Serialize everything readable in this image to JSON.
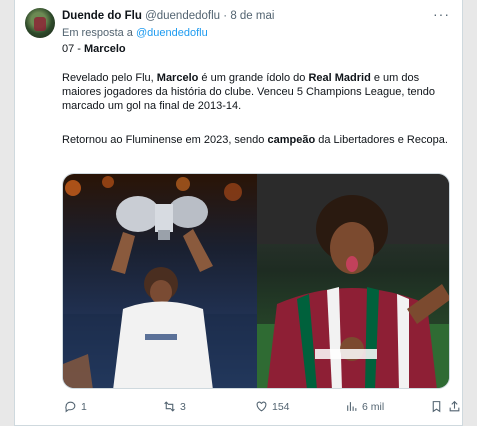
{
  "tweet": {
    "author_name": "Duende do Flu",
    "handle": "@duendedoflu",
    "separator": "·",
    "date": "8 de mai",
    "more_glyph": "···",
    "reply_prefix": "Em resposta a",
    "reply_to": "@duendedoflu",
    "number_prefix": "07 - ",
    "player": "Marcelo",
    "p1_a": "Revelado pelo Flu, ",
    "p1_b": "Marcelo",
    "p1_c": " é um grande ídolo do ",
    "p1_d": "Real Madrid",
    "p1_e": " e um dos maiores jogadores da história do clube. Venceu 5 Champions League, tendo marcado um gol na final de 2013-14.",
    "p2_a": "Retornou ao Fluminense em 2023, sendo ",
    "p2_b": "campeão",
    "p2_c": " da Libertadores e Recopa."
  },
  "media": [
    {
      "icon": "photo-real-madrid-trophy",
      "alt": ""
    },
    {
      "icon": "photo-fluminense-shirt",
      "alt": ""
    }
  ],
  "actions": {
    "replies": "1",
    "retweets": "3",
    "likes": "154",
    "views": "6 mil"
  },
  "colors": {
    "link": "#1d9bf0",
    "muted": "#536471",
    "fluminense_maroon": "#8e1f35",
    "fluminense_green": "#00613c"
  }
}
